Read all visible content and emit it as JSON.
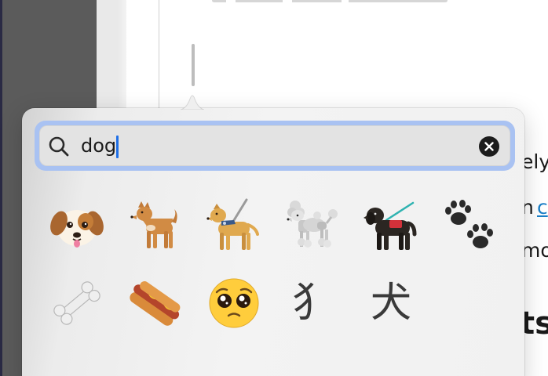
{
  "background": {
    "doc_fragments": [
      "ely",
      "n",
      "mo",
      "ts"
    ],
    "doc_link": "c"
  },
  "picker": {
    "search": {
      "value": "dog",
      "icon": "search-icon",
      "clear_icon": "clear-icon"
    },
    "accent_color": "#1f6fe6",
    "results": [
      {
        "name": "dog-face-emoji",
        "type": "emoji"
      },
      {
        "name": "dog-emoji",
        "type": "emoji"
      },
      {
        "name": "guide-dog-emoji",
        "type": "emoji"
      },
      {
        "name": "poodle-emoji",
        "type": "emoji"
      },
      {
        "name": "service-dog-emoji",
        "type": "emoji"
      },
      {
        "name": "paw-prints-emoji",
        "type": "emoji"
      },
      {
        "name": "bone-emoji",
        "type": "emoji"
      },
      {
        "name": "hot-dog-emoji",
        "type": "emoji"
      },
      {
        "name": "pleading-face-emoji",
        "type": "emoji"
      },
      {
        "name": "radical-dog-glyph",
        "type": "glyph",
        "char": "犭"
      },
      {
        "name": "kanji-dog-glyph",
        "type": "glyph",
        "char": "犬"
      }
    ]
  }
}
